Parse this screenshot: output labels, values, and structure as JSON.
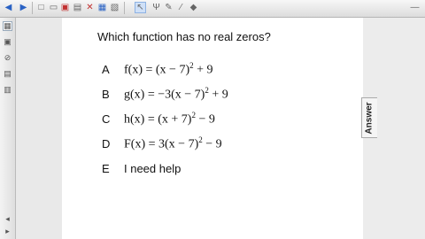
{
  "question": "Which function has no real zeros?",
  "choices": [
    {
      "letter": "A",
      "lhs": "f(x) = (x − 7)",
      "exp": "2",
      "rhs": " + 9"
    },
    {
      "letter": "B",
      "lhs": "g(x) = −3(x − 7)",
      "exp": "2",
      "rhs": " + 9"
    },
    {
      "letter": "C",
      "lhs": "h(x) = (x + 7)",
      "exp": "2",
      "rhs": " − 9"
    },
    {
      "letter": "D",
      "lhs": "F(x) = 3(x − 7)",
      "exp": "2",
      "rhs": " − 9"
    },
    {
      "letter": "E",
      "text": "I need help"
    }
  ],
  "answer_tab": "Answer",
  "toolbar_icons": [
    "back-arrow-icon",
    "forward-arrow-icon",
    "new-page-icon",
    "open-icon",
    "save-icon",
    "delete-icon",
    "capture-icon",
    "screen-shade-icon",
    "select-arrow-icon",
    "text-format-icon",
    "pen-icon",
    "eraser-icon",
    "minimize-icon"
  ],
  "accent": "#2a62c4"
}
